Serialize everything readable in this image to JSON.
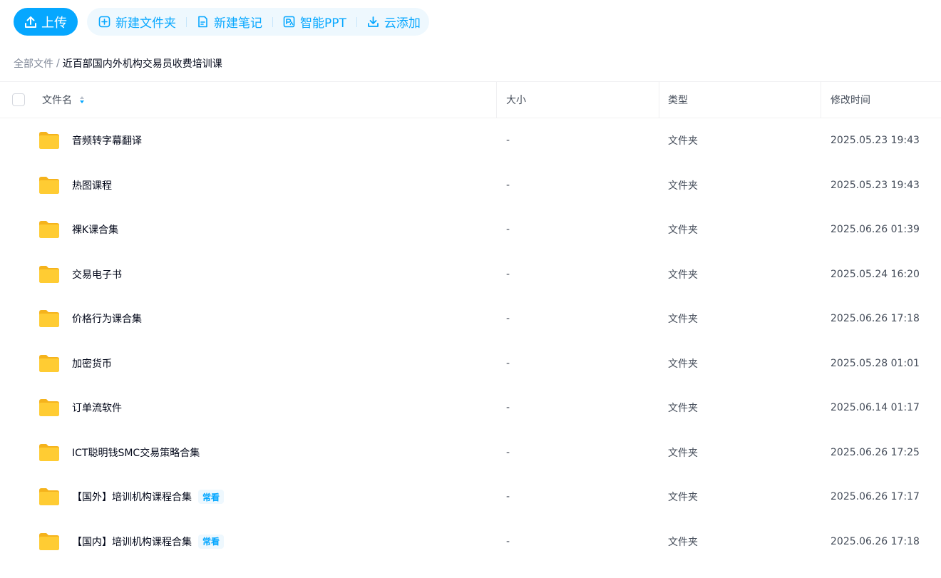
{
  "toolbar": {
    "upload_label": "上传",
    "actions": [
      {
        "label": "新建文件夹",
        "icon": "new-folder-icon"
      },
      {
        "label": "新建笔记",
        "icon": "note-icon"
      },
      {
        "label": "智能PPT",
        "icon": "ppt-icon"
      },
      {
        "label": "云添加",
        "icon": "cloud-add-icon"
      }
    ]
  },
  "breadcrumb": {
    "root": "全部文件",
    "separator": "/",
    "current": "近百部国内外机构交易员收费培训课"
  },
  "columns": {
    "name": "文件名",
    "size": "大小",
    "type": "类型",
    "modified": "修改时间"
  },
  "rows": [
    {
      "name": "音频转字幕翻译",
      "size": "-",
      "type": "文件夹",
      "modified": "2025.05.23 19:43",
      "badge": ""
    },
    {
      "name": "热图课程",
      "size": "-",
      "type": "文件夹",
      "modified": "2025.05.23 19:43",
      "badge": ""
    },
    {
      "name": "裸K课合集",
      "size": "-",
      "type": "文件夹",
      "modified": "2025.06.26 01:39",
      "badge": ""
    },
    {
      "name": "交易电子书",
      "size": "-",
      "type": "文件夹",
      "modified": "2025.05.24 16:20",
      "badge": ""
    },
    {
      "name": "价格行为课合集",
      "size": "-",
      "type": "文件夹",
      "modified": "2025.06.26 17:18",
      "badge": ""
    },
    {
      "name": "加密货币",
      "size": "-",
      "type": "文件夹",
      "modified": "2025.05.28 01:01",
      "badge": ""
    },
    {
      "name": "订单流软件",
      "size": "-",
      "type": "文件夹",
      "modified": "2025.06.14 01:17",
      "badge": ""
    },
    {
      "name": "ICT聪明钱SMC交易策略合集",
      "size": "-",
      "type": "文件夹",
      "modified": "2025.06.26 17:25",
      "badge": ""
    },
    {
      "name": "【国外】培训机构课程合集",
      "size": "-",
      "type": "文件夹",
      "modified": "2025.06.26 17:17",
      "badge": "常看"
    },
    {
      "name": "【国内】培训机构课程合集",
      "size": "-",
      "type": "文件夹",
      "modified": "2025.06.26 17:18",
      "badge": "常看"
    }
  ],
  "colors": {
    "accent": "#06a7ff",
    "accent_light": "#eef8fe",
    "folder": "#ffc62e"
  }
}
